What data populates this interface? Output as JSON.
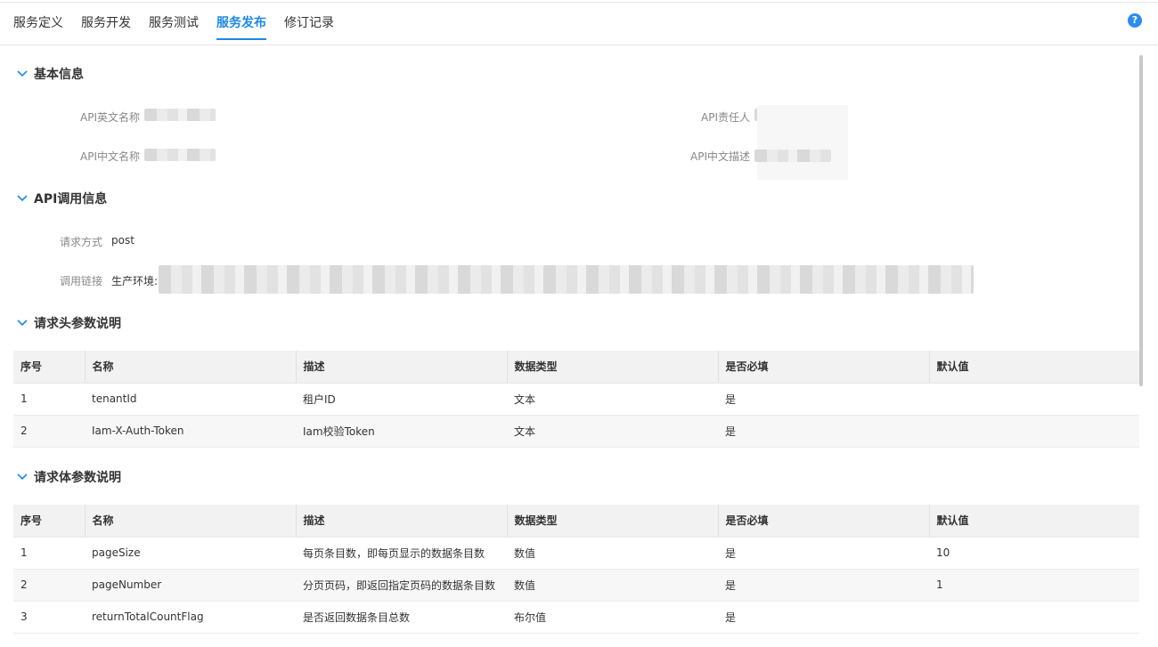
{
  "tabs": [
    {
      "label": "服务定义"
    },
    {
      "label": "服务开发"
    },
    {
      "label": "服务测试"
    },
    {
      "label": "服务发布",
      "active": true
    },
    {
      "label": "修订记录"
    }
  ],
  "help_icon": "question-circle-icon",
  "basic_info": {
    "title": "基本信息",
    "fields": {
      "api_en_name_label": "API英文名称",
      "api_owner_label": "API责任人",
      "api_cn_name_label": "API中文名称",
      "api_cn_desc_label": "API中文描述"
    }
  },
  "call_info": {
    "title": "API调用信息",
    "method_label": "请求方式",
    "method_value": "post",
    "link_label": "调用链接",
    "link_prefix": "生产环境:"
  },
  "header_params": {
    "title": "请求头参数说明",
    "columns": [
      "序号",
      "名称",
      "描述",
      "数据类型",
      "是否必填",
      "默认值"
    ],
    "rows": [
      [
        "1",
        "tenantId",
        "租户ID",
        "文本",
        "是",
        ""
      ],
      [
        "2",
        "Iam-X-Auth-Token",
        "Iam校验Token",
        "文本",
        "是",
        ""
      ]
    ]
  },
  "body_params": {
    "title": "请求体参数说明",
    "columns": [
      "序号",
      "名称",
      "描述",
      "数据类型",
      "是否必填",
      "默认值"
    ],
    "rows": [
      [
        "1",
        "pageSize",
        "每页条目数，即每页显示的数据条目数",
        "数值",
        "是",
        "10"
      ],
      [
        "2",
        "pageNumber",
        "分页页码，即返回指定页码的数据条目数",
        "数值",
        "是",
        "1"
      ],
      [
        "3",
        "returnTotalCountFlag",
        "是否返回数据条目总数",
        "布尔值",
        "是",
        ""
      ]
    ]
  },
  "colors": {
    "accent": "#1e88e5",
    "header_bg": "#f2f2f2"
  }
}
